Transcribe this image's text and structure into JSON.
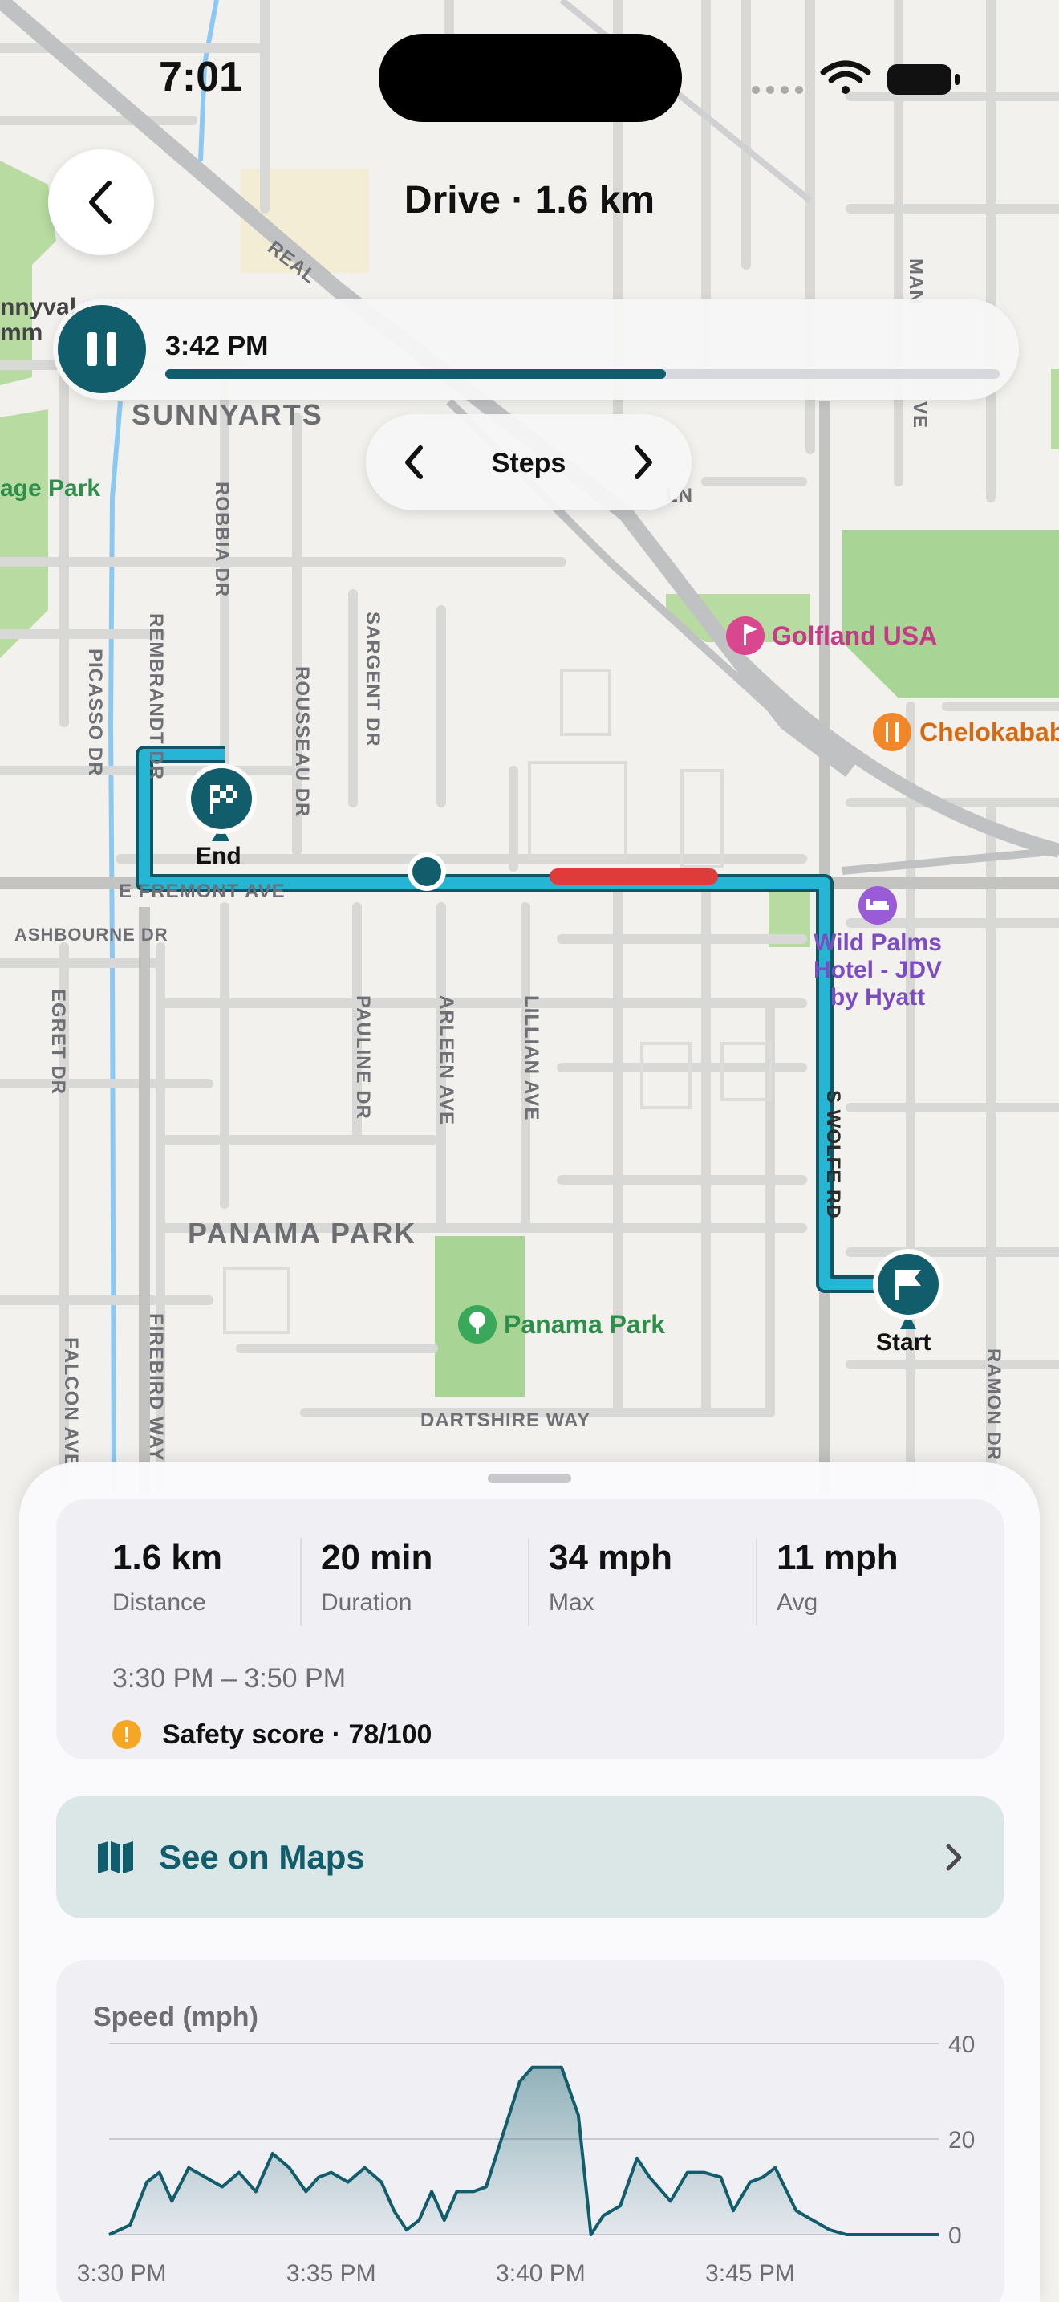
{
  "status_bar": {
    "time": "7:01"
  },
  "header": {
    "title": "Drive · 1.6 km"
  },
  "playback": {
    "time": "3:42 PM",
    "progress": 0.6
  },
  "steps": {
    "label": "Steps"
  },
  "map": {
    "streets": {
      "real": "REAL",
      "man": "MAN",
      "fremont": "E FREMONT AVE",
      "ashbourne": "ASHBOURNE DR",
      "robbia": "ROBBIA DR",
      "rembrandt": "REMBRANDT DR",
      "picasso": "PICASSO DR",
      "rousseau": "ROUSSEAU DR",
      "sargent": "SARGENT DR",
      "egret": "EGRET DR",
      "pauline": "PAULINE DR",
      "arleen": "ARLEEN AVE",
      "lillian": "LILLIAN AVE",
      "wolfe": "S WOLFE RD",
      "ramon": "RAMON DR",
      "falcon": "FALCON AVE",
      "firebird": "FIREBIRD WAY",
      "dartshire": "DARTSHIRE WAY",
      "ln": "LN",
      "ve": "VE"
    },
    "areas": {
      "sunnyarts": "SUNNYARTS",
      "panama": "PANAMA PARK"
    },
    "pois": {
      "sunnyvale_1": "nnyval",
      "sunnyvale_2": "mm",
      "age_park": "age Park",
      "golfland": "Golfland USA",
      "chelokabab": "Chelokabab",
      "wild_palms_1": "Wild Palms",
      "wild_palms_2": "Hotel - JDV",
      "wild_palms_3": "by Hyatt",
      "panama_park": "Panama Park"
    },
    "markers": {
      "end": "End",
      "start": "Start"
    }
  },
  "summary": {
    "stats": [
      {
        "value": "1.6 km",
        "label": "Distance"
      },
      {
        "value": "20 min",
        "label": "Duration"
      },
      {
        "value": "34 mph",
        "label": "Max"
      },
      {
        "value": "11 mph",
        "label": "Avg"
      }
    ],
    "time_range": "3:30 PM – 3:50 PM",
    "safety": "Safety score · 78/100"
  },
  "maps_button": {
    "label": "See on Maps"
  },
  "chart_data": {
    "type": "area",
    "title": "Speed (mph)",
    "ylim": [
      0,
      40
    ],
    "y_ticks": [
      "0",
      "20",
      "40"
    ],
    "x_ticks": [
      {
        "label": "3:30 PM",
        "t": 0.5
      },
      {
        "label": "3:35 PM",
        "t": 5.5
      },
      {
        "label": "3:40 PM",
        "t": 10.5
      },
      {
        "label": "3:45 PM",
        "t": 15.5
      }
    ],
    "x_range": [
      0.2,
      20.0
    ],
    "x": [
      0.2,
      0.7,
      1.1,
      1.4,
      1.7,
      2.1,
      2.5,
      2.9,
      3.3,
      3.7,
      4.1,
      4.5,
      4.9,
      5.2,
      5.5,
      5.9,
      6.3,
      6.7,
      7.0,
      7.3,
      7.6,
      7.9,
      8.2,
      8.5,
      8.9,
      9.2,
      9.6,
      10.0,
      10.3,
      10.6,
      11.0,
      11.4,
      11.7,
      12.0,
      12.4,
      12.8,
      13.1,
      13.6,
      14.0,
      14.4,
      14.8,
      15.1,
      15.5,
      15.8,
      16.1,
      16.6,
      17.0,
      17.4,
      17.8,
      18.1,
      18.5,
      19.0,
      19.5,
      20.0
    ],
    "y": [
      0,
      2,
      11,
      13,
      7,
      14,
      12,
      10,
      13,
      9,
      17,
      14,
      9,
      12,
      13,
      11,
      14,
      11,
      5,
      1,
      3,
      9,
      3,
      9,
      9,
      10,
      21,
      32,
      35,
      35,
      35,
      25,
      0,
      4,
      6,
      16,
      12,
      7,
      13,
      13,
      12,
      5,
      11,
      12,
      14,
      5,
      3,
      1,
      0,
      0,
      0,
      0,
      0,
      0
    ]
  }
}
